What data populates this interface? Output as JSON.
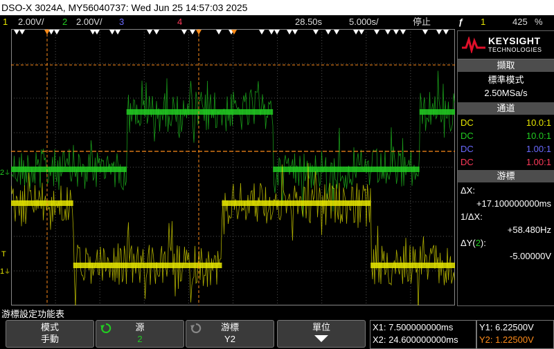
{
  "title": "DSO-X 3024A, MY56040737: Wed Jun 25 14:57:03 2025",
  "status": {
    "ch1_num": "1",
    "ch1_scale": "2.00V/",
    "ch2_num": "2",
    "ch2_scale": "2.00V/",
    "ch3_num": "3",
    "ch4_num": "4",
    "h_position": "28.50s",
    "time_scale": "5.000s/",
    "run_state": "停止",
    "trigger_source": "1",
    "trigger_level": "425",
    "trigger_unit": "%"
  },
  "colors": {
    "ch1": "#e8e800",
    "ch2": "#22cc22",
    "ch3": "#6a6aff",
    "ch4": "#ff3a5a",
    "cursor": "#ff8c1a"
  },
  "panel": {
    "brand": "KEYSIGHT",
    "brand_sub": "TECHNOLOGIES",
    "acquire_header": "擷取",
    "acquire_mode": "標準模式",
    "sample_rate": "2.50MSa/s",
    "channel_header": "通道",
    "channels": [
      {
        "coupling": "DC",
        "probe": "10.0:1"
      },
      {
        "coupling": "DC",
        "probe": "10.0:1"
      },
      {
        "coupling": "DC",
        "probe": "1.00:1"
      },
      {
        "coupling": "DC",
        "probe": "1.00:1"
      }
    ],
    "cursor_header": "游標",
    "dx_label": "ΔX:",
    "dx_value": "+17.100000000ms",
    "inv_dx_label": "1/ΔX:",
    "inv_dx_value": "+58.480Hz",
    "dy_label_pre": "ΔY(",
    "dy_label_ch": "2",
    "dy_label_post": "):",
    "dy_value": "-5.00000V"
  },
  "menu": {
    "title": "游標設定功能表",
    "softkeys": [
      {
        "title": "模式",
        "value": "手動"
      },
      {
        "title": "源",
        "value": "2"
      },
      {
        "title": "游標",
        "value": "Y2"
      },
      {
        "title": "單位",
        "value": ""
      }
    ]
  },
  "cursors": {
    "x1": "X1: 7.500000000ms",
    "x2": "X2: 24.600000000ms",
    "y1": "Y1: 6.22500V",
    "y2": "Y2: 1.22500V"
  },
  "waveforms": {
    "ch1_levels": [
      {
        "from": 0.0,
        "to": 0.14,
        "level": "high"
      },
      {
        "from": 0.14,
        "to": 0.475,
        "level": "low"
      },
      {
        "from": 0.475,
        "to": 0.81,
        "level": "high"
      },
      {
        "from": 0.81,
        "to": 1.0,
        "level": "low"
      }
    ],
    "ch2_levels": [
      {
        "from": 0.0,
        "to": 0.26,
        "level": "low"
      },
      {
        "from": 0.26,
        "to": 0.59,
        "level": "high"
      },
      {
        "from": 0.59,
        "to": 0.92,
        "level": "low"
      },
      {
        "from": 0.92,
        "to": 1.0,
        "level": "high"
      }
    ]
  }
}
